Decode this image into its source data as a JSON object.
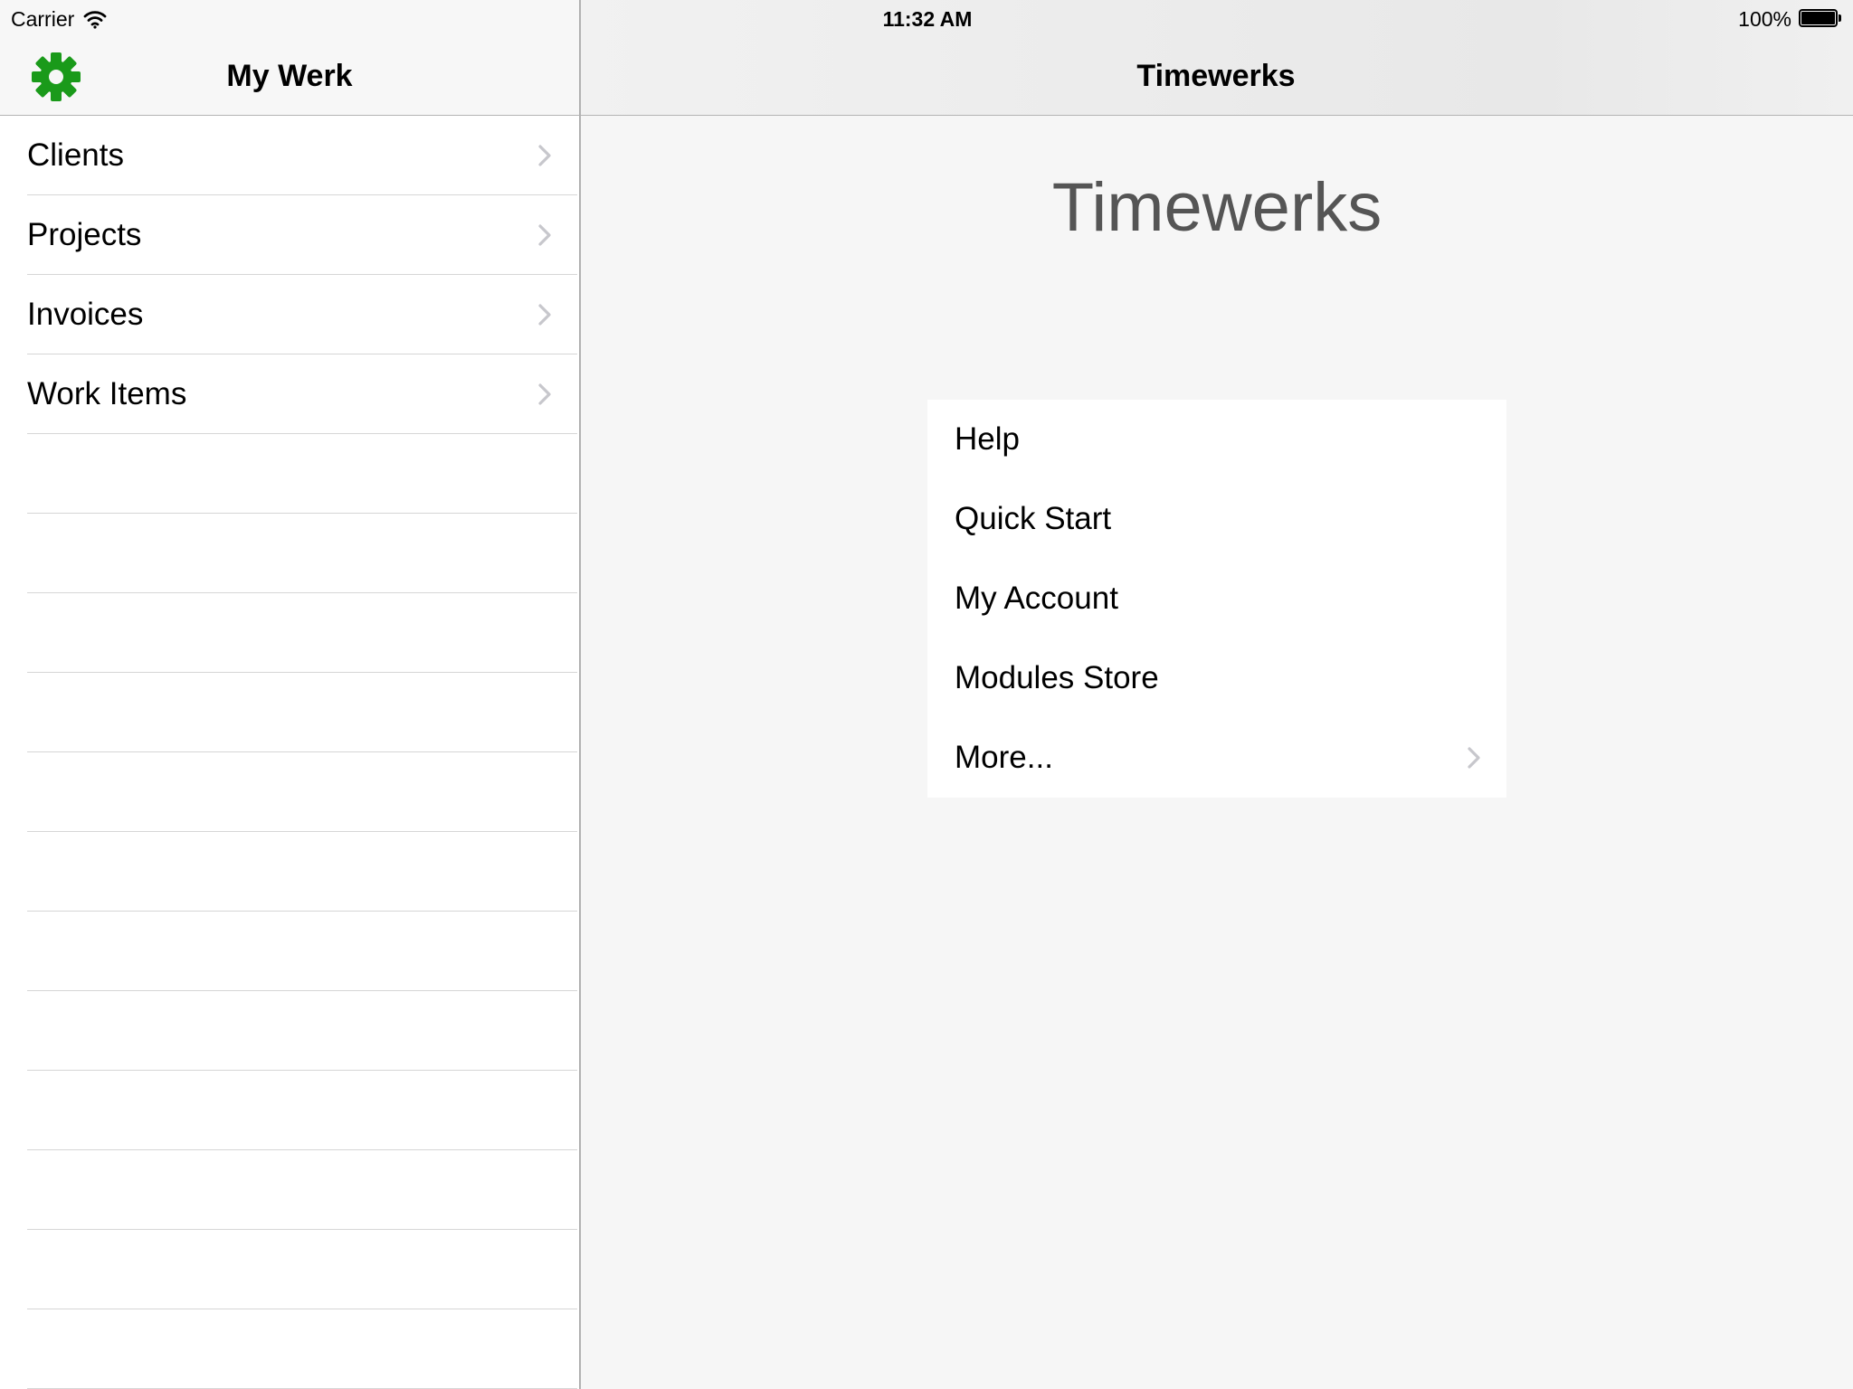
{
  "status_bar": {
    "carrier": "Carrier",
    "time": "11:32 AM",
    "battery": "100%",
    "wifi_icon": "wifi-icon",
    "battery_icon": "battery-full-icon"
  },
  "master": {
    "title": "My Werk",
    "settings_icon": "gear-icon",
    "accent_color": "#1a9a1a",
    "items": [
      {
        "label": "Clients",
        "icon": "chevron-right-icon"
      },
      {
        "label": "Projects",
        "icon": "chevron-right-icon"
      },
      {
        "label": "Invoices",
        "icon": "chevron-right-icon"
      },
      {
        "label": "Work Items",
        "icon": "chevron-right-icon"
      }
    ]
  },
  "detail": {
    "nav_title": "Timewerks",
    "heading": "Timewerks",
    "menu": [
      {
        "label": "Help"
      },
      {
        "label": "Quick Start"
      },
      {
        "label": "My Account"
      },
      {
        "label": "Modules Store"
      },
      {
        "label": "More...",
        "icon": "chevron-right-icon"
      }
    ]
  }
}
